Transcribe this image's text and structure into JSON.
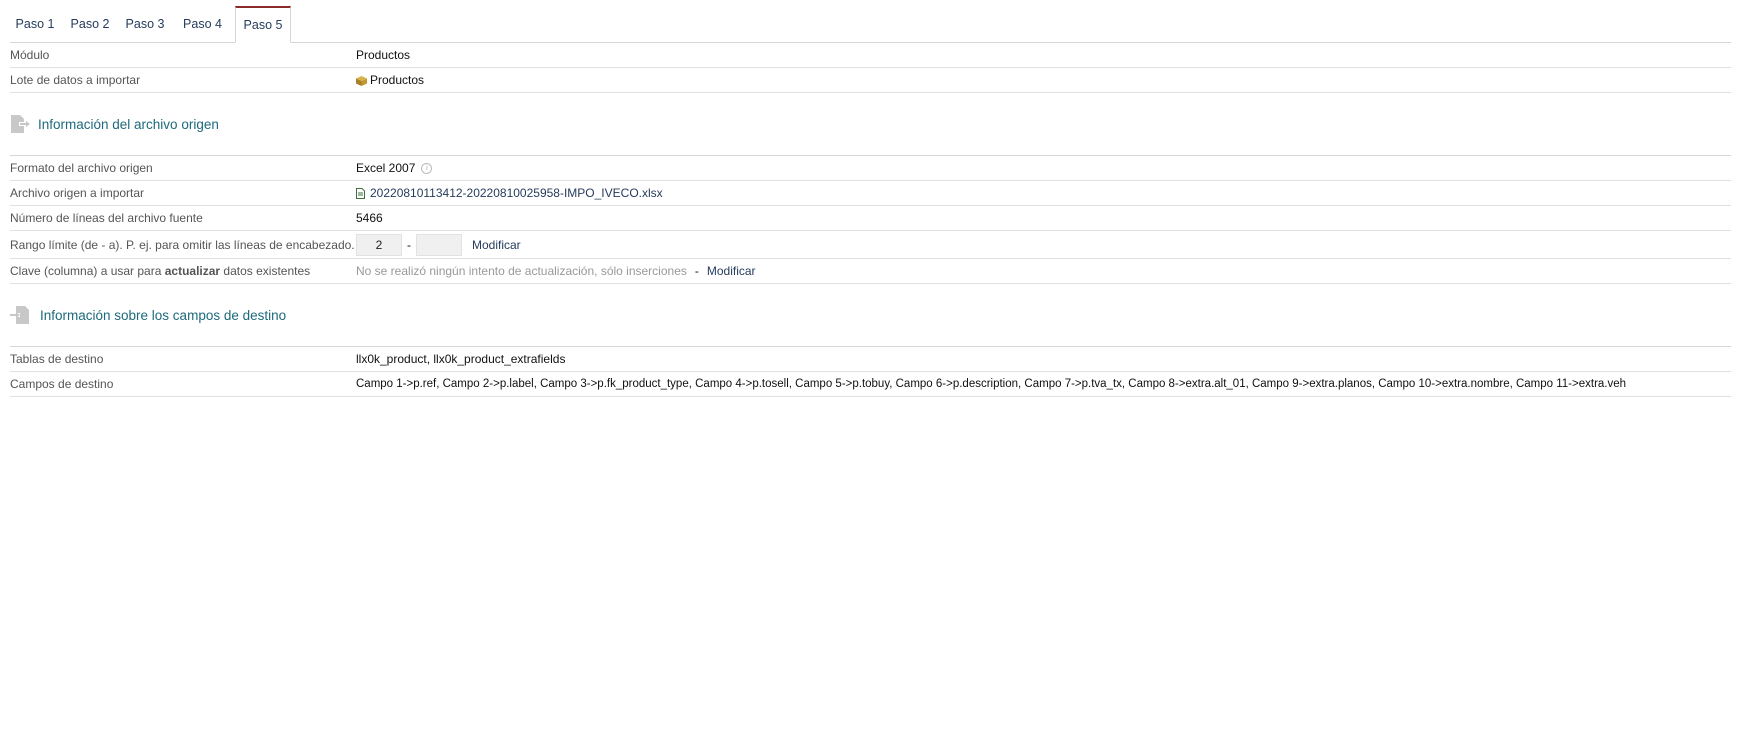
{
  "tabs": [
    "Paso 1",
    "Paso 2",
    "Paso 3",
    "Paso 4",
    "Paso 5"
  ],
  "module": {
    "label": "Módulo",
    "value": "Productos"
  },
  "batch": {
    "label": "Lote de datos a importar",
    "value": "Productos"
  },
  "section_source": {
    "title": "Información del archivo origen"
  },
  "format": {
    "label": "Formato del archivo origen",
    "value": "Excel 2007"
  },
  "file": {
    "label": "Archivo origen a importar",
    "value": "20220810113412-20220810025958-IMPO_IVECO.xlsx"
  },
  "lines": {
    "label": "Número de líneas del archivo fuente",
    "value": "5466"
  },
  "range": {
    "label": "Rango límite (de - a). P. ej. para omitir las líneas de encabezado.",
    "from": "2",
    "to": "",
    "sep": "-",
    "modify": "Modificar"
  },
  "key": {
    "label_a": "Clave (columna) a usar para ",
    "label_b": "actualizar",
    "label_c": " datos existentes",
    "value": "No se realizó ningún intento de actualización, sólo inserciones",
    "sep": "-",
    "modify": "Modificar"
  },
  "section_target": {
    "title": "Información sobre los campos de destino"
  },
  "tables": {
    "label": "Tablas de destino",
    "value": "llx0k_product, llx0k_product_extrafields"
  },
  "fields": {
    "label": "Campos de destino",
    "value": "Campo 1->p.ref, Campo 2->p.label, Campo 3->p.fk_product_type, Campo 4->p.tosell, Campo 5->p.tobuy, Campo 6->p.description, Campo 7->p.tva_tx, Campo 8->extra.alt_01, Campo 9->extra.planos, Campo 10->extra.nombre, Campo 11->extra.veh"
  }
}
